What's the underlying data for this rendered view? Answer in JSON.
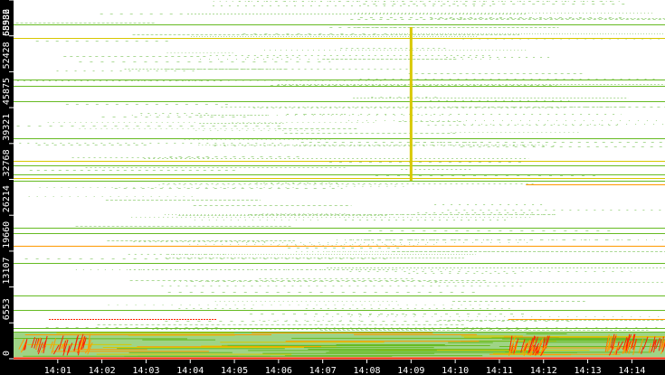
{
  "chart_data": {
    "type": "heatmap",
    "title": "",
    "xlabel": "",
    "ylabel": "",
    "x_unit": "minutes after 14:00",
    "xlim": [
      0,
      14.75
    ],
    "ylim": [
      0,
      65536
    ],
    "xticks": [
      {
        "v": 1,
        "label": "14:01"
      },
      {
        "v": 2,
        "label": "14:02"
      },
      {
        "v": 3,
        "label": "14:03"
      },
      {
        "v": 4,
        "label": "14:04"
      },
      {
        "v": 5,
        "label": "14:05"
      },
      {
        "v": 6,
        "label": "14:06"
      },
      {
        "v": 7,
        "label": "14:07"
      },
      {
        "v": 8,
        "label": "14:08"
      },
      {
        "v": 9,
        "label": "14:09"
      },
      {
        "v": 10,
        "label": "14:10"
      },
      {
        "v": 11,
        "label": "14:11"
      },
      {
        "v": 12,
        "label": "14:12"
      },
      {
        "v": 13,
        "label": "14:13"
      },
      {
        "v": 14,
        "label": "14:14"
      }
    ],
    "yticks": [
      {
        "v": 0,
        "label": "0"
      },
      {
        "v": 6553,
        "label": "6553"
      },
      {
        "v": 13107,
        "label": "13107"
      },
      {
        "v": 19660,
        "label": "19660"
      },
      {
        "v": 26214,
        "label": "26214"
      },
      {
        "v": 32768,
        "label": "32768"
      },
      {
        "v": 39321,
        "label": "39321"
      },
      {
        "v": 45875,
        "label": "45875"
      },
      {
        "v": 52428,
        "label": "52428"
      },
      {
        "v": 58982,
        "label": "58982"
      },
      {
        "v": 65536,
        "label": "65536"
      }
    ],
    "colors": {
      "low": "#9fd486",
      "mid": "#66bb22",
      "high": "#d8c800",
      "higher": "#ff9900",
      "max": "#ff2200",
      "background": "#ffffff",
      "axis": "#000000"
    },
    "lines": [
      {
        "value": 61080,
        "start": 0,
        "end": 14.75,
        "level": "mid"
      },
      {
        "value": 58603,
        "start": 0,
        "end": 14.75,
        "level": "high"
      },
      {
        "value": 51010,
        "start": 0,
        "end": 14.75,
        "level": "mid"
      },
      {
        "value": 49855,
        "start": 0,
        "end": 14.75,
        "level": "mid"
      },
      {
        "value": 47047,
        "start": 0,
        "end": 14.75,
        "level": "mid"
      },
      {
        "value": 40279,
        "start": 0,
        "end": 14.75,
        "level": "mid"
      },
      {
        "value": 36152,
        "start": 0,
        "end": 14.75,
        "level": "high"
      },
      {
        "value": 35327,
        "start": 0,
        "end": 14.75,
        "level": "mid"
      },
      {
        "value": 33676,
        "start": 0,
        "end": 14.75,
        "level": "mid"
      },
      {
        "value": 33016,
        "start": 0,
        "end": 14.75,
        "level": "high"
      },
      {
        "value": 32521,
        "start": 0,
        "end": 14.75,
        "level": "mid"
      },
      {
        "value": 31860,
        "start": 11.6,
        "end": 14.75,
        "level": "higher"
      },
      {
        "value": 23937,
        "start": 0,
        "end": 14.75,
        "level": "mid"
      },
      {
        "value": 22946,
        "start": 0,
        "end": 14.75,
        "level": "mid"
      },
      {
        "value": 20635,
        "start": 0,
        "end": 14.75,
        "level": "higher"
      },
      {
        "value": 17498,
        "start": 0,
        "end": 14.75,
        "level": "mid"
      },
      {
        "value": 11555,
        "start": 0,
        "end": 14.75,
        "level": "mid"
      },
      {
        "value": 8914,
        "start": 0,
        "end": 14.75,
        "level": "mid"
      },
      {
        "value": 7263,
        "start": 0.8,
        "end": 4.6,
        "level": "max"
      },
      {
        "value": 7263,
        "start": 11.2,
        "end": 14.75,
        "level": "higher"
      },
      {
        "value": 5610,
        "start": 0,
        "end": 14.75,
        "level": "mid"
      },
      {
        "value": 4950,
        "start": 0,
        "end": 14.75,
        "level": "mid"
      },
      {
        "value": 0,
        "start": 0,
        "end": 14.75,
        "level": "max"
      }
    ],
    "spike": {
      "x": 9.0,
      "from": 32500,
      "to": 60600,
      "level": "high"
    },
    "dense_band": {
      "from": 300,
      "to": 4900,
      "level": "low"
    },
    "hotspots": [
      {
        "start": 0.1,
        "end": 1.7,
        "from": 500,
        "to": 4500,
        "level": "max"
      },
      {
        "start": 11.2,
        "end": 12.1,
        "from": 500,
        "to": 4200,
        "level": "max"
      },
      {
        "start": 13.4,
        "end": 14.75,
        "from": 500,
        "to": 4500,
        "level": "max"
      }
    ]
  }
}
